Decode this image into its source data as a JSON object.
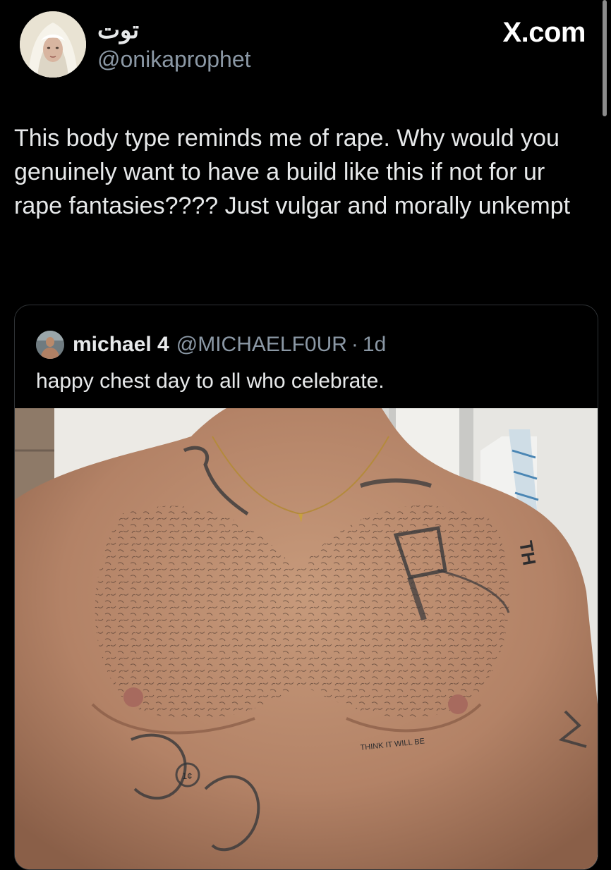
{
  "tweet": {
    "author": {
      "display_name": "توت",
      "handle": "@onikaprophet",
      "avatar": "portrait-avatar"
    },
    "site_logo": "X.com",
    "text": "This body type reminds me of rape. Why would you genuinely want to have a build like this if not for ur rape fantasies???? Just vulgar and morally unkempt"
  },
  "quoted_tweet": {
    "author": {
      "display_name": "michael 4",
      "handle": "@MICHAELF0UR",
      "avatar": "selfie-avatar"
    },
    "separator": "·",
    "time": "1d",
    "text": "happy chest day to all who celebrate.",
    "media": "bare-chest-photo",
    "photo_tattoo_texts": [
      "1¢",
      "THINK IT WILL BE",
      "TH"
    ]
  },
  "colors": {
    "background": "#000000",
    "text_primary": "#e7e9ea",
    "text_secondary": "#8b98a5",
    "border": "#2f3336"
  }
}
